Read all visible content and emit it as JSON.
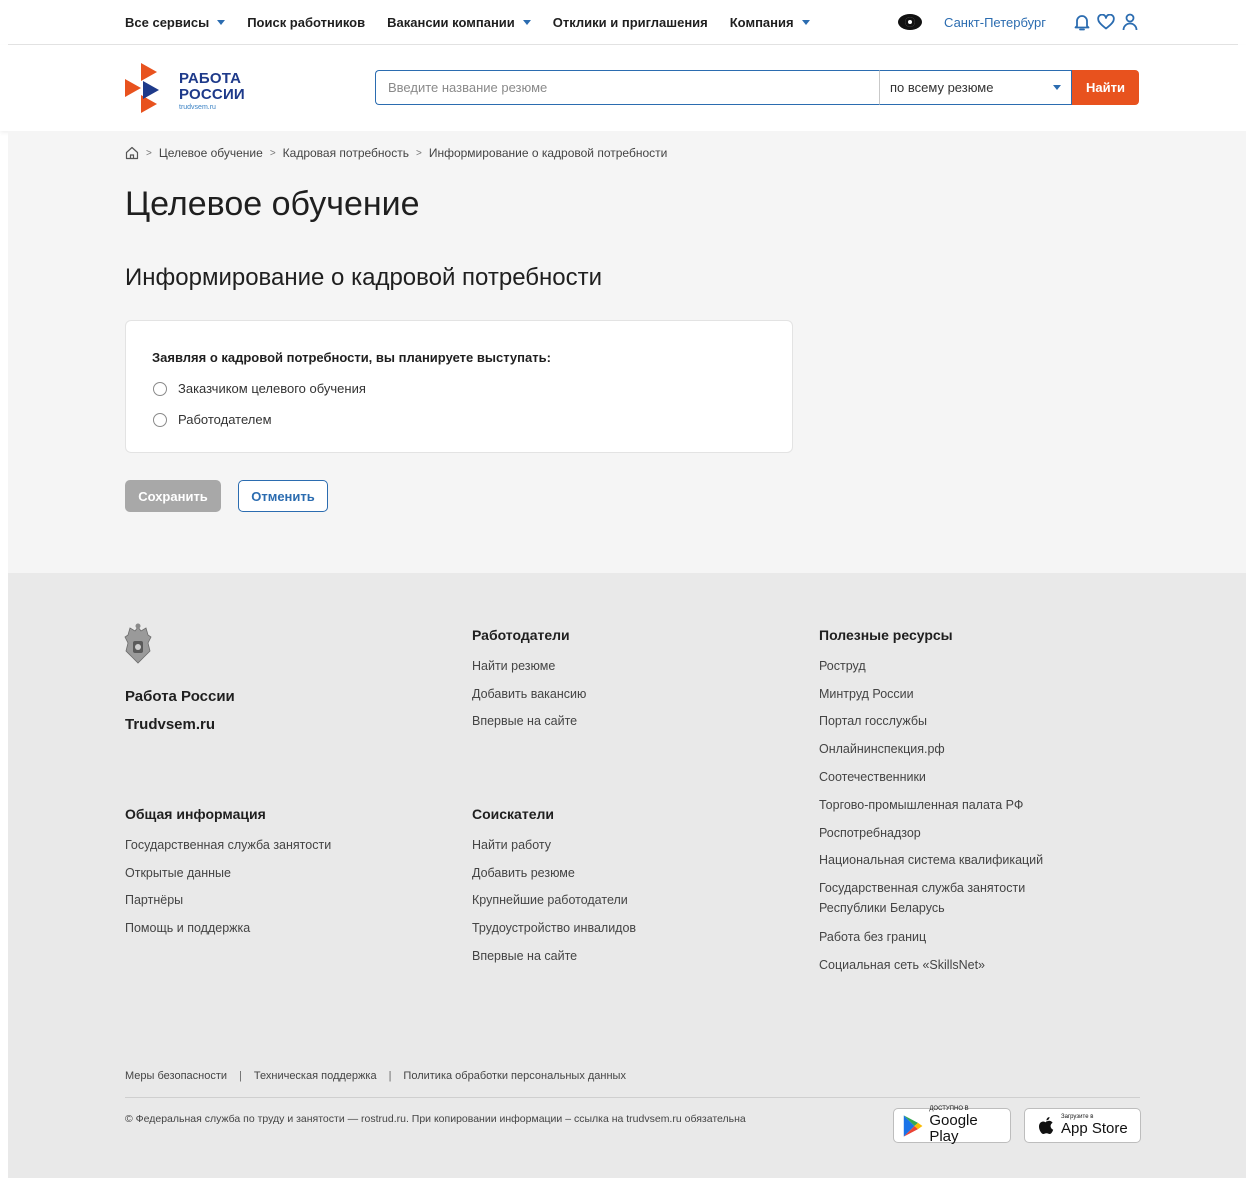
{
  "topnav": {
    "items": [
      {
        "label": "Все сервисы",
        "dropdown": true
      },
      {
        "label": "Поиск работников",
        "dropdown": false
      },
      {
        "label": "Вакансии компании",
        "dropdown": true
      },
      {
        "label": "Отклики и приглашения",
        "dropdown": false
      },
      {
        "label": "Компания",
        "dropdown": true
      }
    ],
    "city": "Санкт-Петербург"
  },
  "logo": {
    "line1": "РАБОТА",
    "line2": "РОССИИ",
    "domain": "trudvsem.ru"
  },
  "search": {
    "placeholder": "Введите название резюме",
    "scope": "по всему резюме",
    "button": "Найти"
  },
  "breadcrumbs": [
    "Целевое обучение",
    "Кадровая потребность",
    "Информирование о кадровой потребности"
  ],
  "page": {
    "title": "Целевое обучение",
    "subtitle": "Информирование о кадровой потребности"
  },
  "form": {
    "question": "Заявляя о кадровой потребности, вы планируете выступать:",
    "options": [
      "Заказчиком целевого обучения",
      "Работодателем"
    ],
    "save": "Сохранить",
    "cancel": "Отменить"
  },
  "footer": {
    "brand1": "Работа России",
    "brand2": "Trudvsem.ru",
    "employers": {
      "title": "Работодатели",
      "links": [
        "Найти резюме",
        "Добавить вакансию",
        "Впервые на сайте"
      ]
    },
    "general": {
      "title": "Общая информация",
      "links": [
        "Государственная служба занятости",
        "Открытые данные",
        "Партнёры",
        "Помощь и поддержка"
      ]
    },
    "seekers": {
      "title": "Соискатели",
      "links": [
        "Найти работу",
        "Добавить резюме",
        "Крупнейшие работодатели",
        "Трудоустройство инвалидов",
        "Впервые на сайте"
      ]
    },
    "resources": {
      "title": "Полезные ресурсы",
      "links": [
        "Роструд",
        "Минтруд России",
        "Портал госслужбы",
        "Онлайнинспекция.рф",
        "Соотечественники",
        "Торгово-промышленная палата РФ",
        "Роспотребнадзор",
        "Национальная система квалификаций",
        "Государственная служба занятости Республики Беларусь",
        "Работа без границ",
        "Социальная сеть «SkillsNet»"
      ]
    },
    "legal": [
      "Меры безопасности",
      "Техническая поддержка",
      "Политика обработки персональных данных"
    ],
    "copyright": "© Федеральная служба по труду и занятости — rostrud.ru. При копировании информации – ссылка на trudvsem.ru обязательна",
    "google": {
      "small": "ДОСТУПНО В",
      "big": "Google Play"
    },
    "apple": {
      "small": "Загрузите в",
      "big": "App Store"
    }
  },
  "colors": {
    "accent": "#2b6cb0",
    "brand_orange": "#e8521e",
    "brand_navy": "#1e3a8a"
  },
  "icons": [
    "caret-down-icon",
    "eye-icon",
    "bell-icon",
    "heart-icon",
    "user-icon",
    "home-icon",
    "emblem-icon",
    "google-play-icon",
    "apple-icon"
  ]
}
